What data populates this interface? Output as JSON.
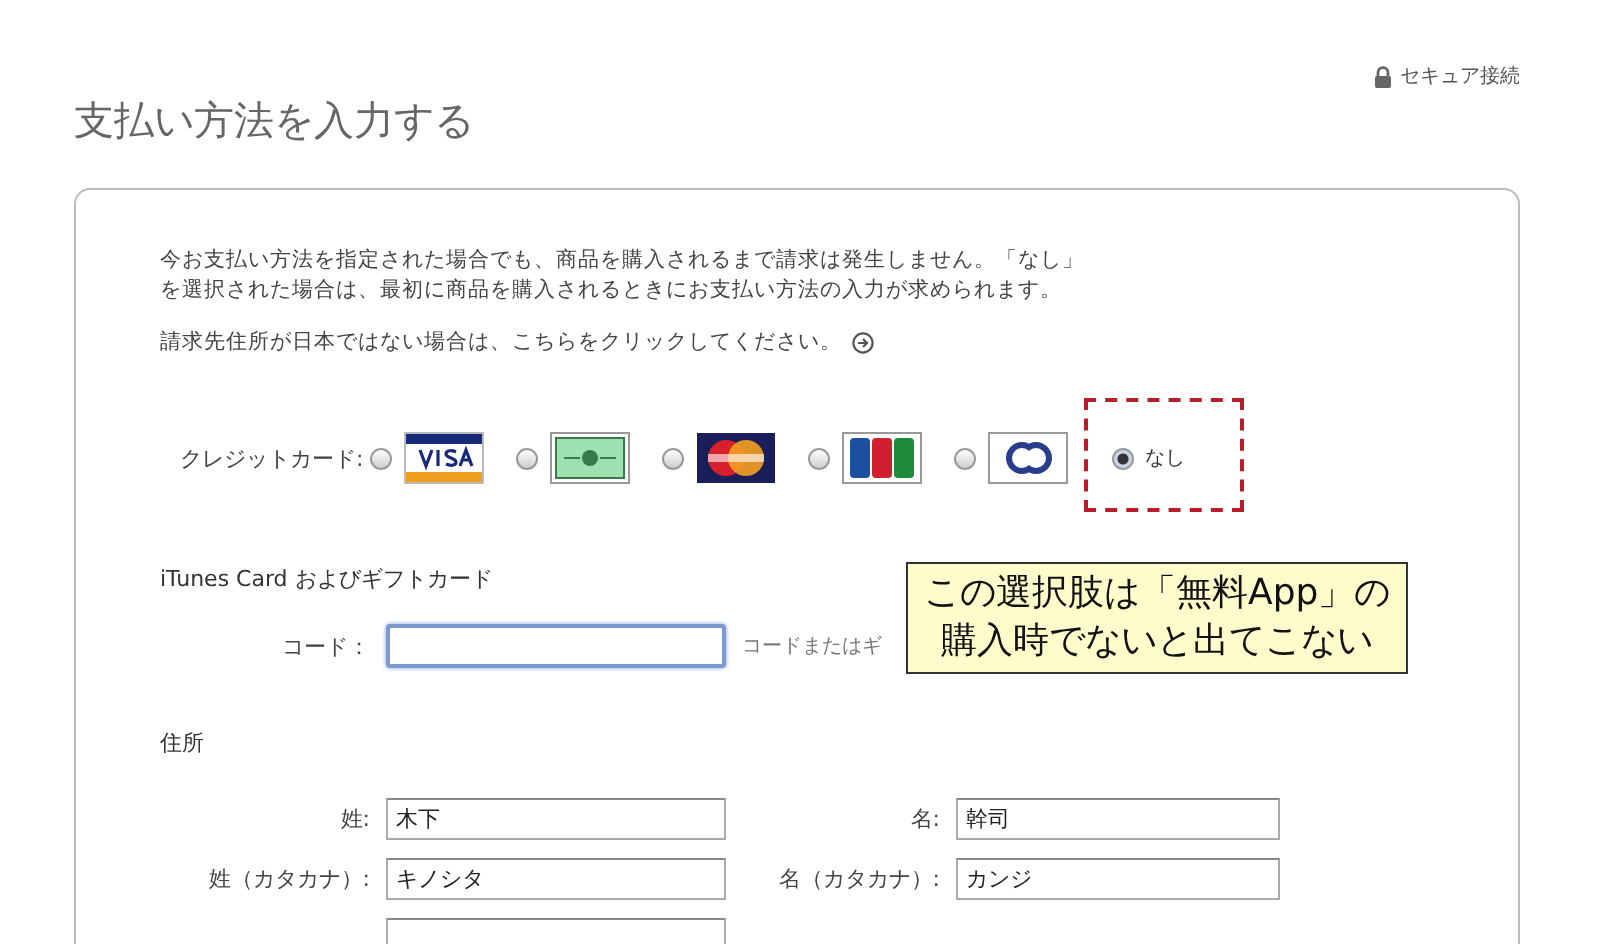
{
  "header": {
    "secure_connection": "セキュア接続",
    "page_title": "支払い方法を入力する"
  },
  "intro": [
    "今お支払い方法を指定された場合でも、商品を購入されるまで請求は発生しません。「なし」",
    "を選択された場合は、最初に商品を購入されるときにお支払い方法の入力が求められます。"
  ],
  "overseas_link": "請求先住所が日本ではない場合は、こちらをクリックしてください。",
  "credit_card": {
    "label": "クレジットカード:",
    "options": [
      {
        "kind": "visa",
        "selected": false
      },
      {
        "kind": "amex",
        "selected": false
      },
      {
        "kind": "mastercard",
        "selected": false
      },
      {
        "kind": "jcb",
        "selected": false
      },
      {
        "kind": "diners",
        "selected": false
      },
      {
        "kind": "none",
        "label": "なし",
        "selected": true
      }
    ]
  },
  "gift_card": {
    "heading": "iTunes Card およびギフトカード",
    "label": "コード：",
    "hint": "コードまたはギ"
  },
  "callout": [
    "この選択肢は「無料App」の",
    "購入時でないと出てこない"
  ],
  "address": {
    "heading": "住所",
    "fields": [
      {
        "label": "姓:",
        "value": "木下"
      },
      {
        "label": "名:",
        "value": "幹司"
      },
      {
        "label": "姓（カタカナ）:",
        "value": "キノシタ"
      },
      {
        "label": "名（カタカナ）:",
        "value": "カンジ"
      }
    ]
  }
}
